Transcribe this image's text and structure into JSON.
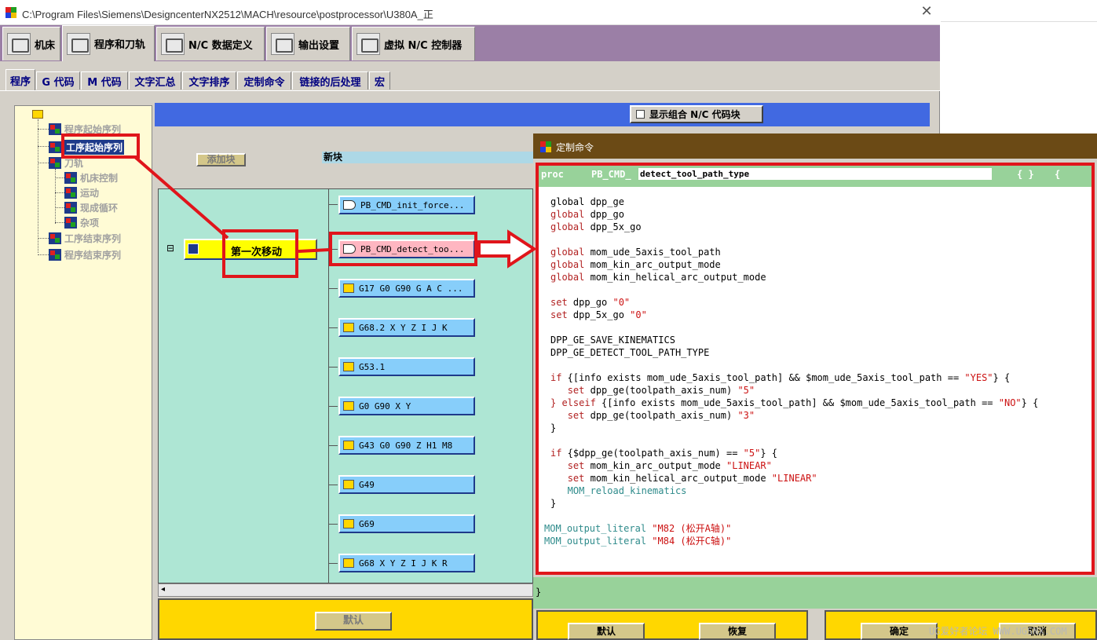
{
  "window": {
    "title": "C:\\Program Files\\Siemens\\DesigncenterNX2512\\MACH\\resource\\postprocessor\\U380A_正",
    "close": "✕"
  },
  "main_tabs": [
    {
      "label": "机床"
    },
    {
      "label": "程序和刀轨"
    },
    {
      "label": "N/C 数据定义"
    },
    {
      "label": "输出设置"
    },
    {
      "label": "虚拟 N/C 控制器"
    }
  ],
  "sub_tabs": [
    {
      "label": "程序"
    },
    {
      "label": "G 代码"
    },
    {
      "label": "M 代码"
    },
    {
      "label": "文字汇总"
    },
    {
      "label": "文字排序"
    },
    {
      "label": "定制命令"
    },
    {
      "label": "链接的后处理"
    },
    {
      "label": "宏"
    }
  ],
  "tree": {
    "nodes": [
      {
        "label": "程序起始序列"
      },
      {
        "label": "工序起始序列"
      },
      {
        "label": "刀轨"
      },
      {
        "label": "机床控制"
      },
      {
        "label": "运动"
      },
      {
        "label": "现成循环"
      },
      {
        "label": "杂项"
      },
      {
        "label": "工序结束序列"
      },
      {
        "label": "程序结束序列"
      }
    ]
  },
  "block_panel": {
    "show_combo_label": "显示组合 N/C 代码块",
    "add_block": "添加块",
    "new_block": "新块",
    "event_label": "第一次移动",
    "expand": "⊟",
    "blocks": [
      {
        "label": "PB_CMD_init_force..."
      },
      {
        "label": "PB_CMD_detect_too..."
      },
      {
        "label": "G17 G0 G90 G A C ..."
      },
      {
        "label": "G68.2 X Y Z I J K"
      },
      {
        "label": "G53.1"
      },
      {
        "label": "G0 G90 X Y"
      },
      {
        "label": "G43 G0 G90 Z H1 M8"
      },
      {
        "label": "G49"
      },
      {
        "label": "G69"
      },
      {
        "label": "G68 X Y Z I J K R"
      }
    ],
    "default_button": "默认"
  },
  "dialog": {
    "title": "定制命令",
    "proc_keyword": "proc",
    "proc_prefix": "PB_CMD_",
    "proc_name": "detect_tool_path_type",
    "proc_braces": "{ }",
    "proc_open": "{",
    "close_brace": "}",
    "code": {
      "l1": "global dpp_ge",
      "l2": "global dpp_go",
      "l3": "global dpp_5x_go",
      "l4": "global mom_ude_5axis_tool_path",
      "l5": "global mom_kin_arc_output_mode",
      "l6": "global mom_kin_helical_arc_output_mode",
      "l7a": "set dpp_go ",
      "l7b": "\"0\"",
      "l8a": "set dpp_5x_go ",
      "l8b": "\"0\"",
      "l9": "DPP_GE_SAVE_KINEMATICS",
      "l10": "DPP_GE_DETECT_TOOL_PATH_TYPE",
      "l11a": "if {[info exists mom_ude_5axis_tool_path] && $mom_ude_5axis_tool_path == ",
      "l11b": "\"YES\"",
      "l11c": "} {",
      "l12a": "   set dpp_ge(toolpath_axis_num) ",
      "l12b": "\"5\"",
      "l13a": "} elseif {[info exists mom_ude_5axis_tool_path] && $mom_ude_5axis_tool_path == ",
      "l13b": "\"NO\"",
      "l13c": "} {",
      "l14a": "   set dpp_ge(toolpath_axis_num) ",
      "l14b": "\"3\"",
      "l15": "}",
      "l16a": "if {$dpp_ge(toolpath_axis_num) == ",
      "l16b": "\"5\"",
      "l16c": "} {",
      "l17a": "   set mom_kin_arc_output_mode ",
      "l17b": "\"LINEAR\"",
      "l18a": "   set mom_kin_helical_arc_output_mode ",
      "l18b": "\"LINEAR\"",
      "l19": "   MOM_reload_kinematics",
      "l20": "}",
      "l21a": "MOM_output_literal ",
      "l21b": "\"M82 (松开A轴)\"",
      "l22a": "MOM_output_literal ",
      "l22b": "\"M84 (松开C轴)\""
    },
    "buttons": {
      "default": "默认",
      "restore": "恢复",
      "ok": "确定",
      "cancel": "取消"
    }
  },
  "watermark": "UG爱好者论坛 WWW.UGSNX.COM",
  "colors": {
    "annotation": "#e0151b",
    "tab_bar": "#9b7fa6",
    "dialog_title": "#6b4a15"
  }
}
